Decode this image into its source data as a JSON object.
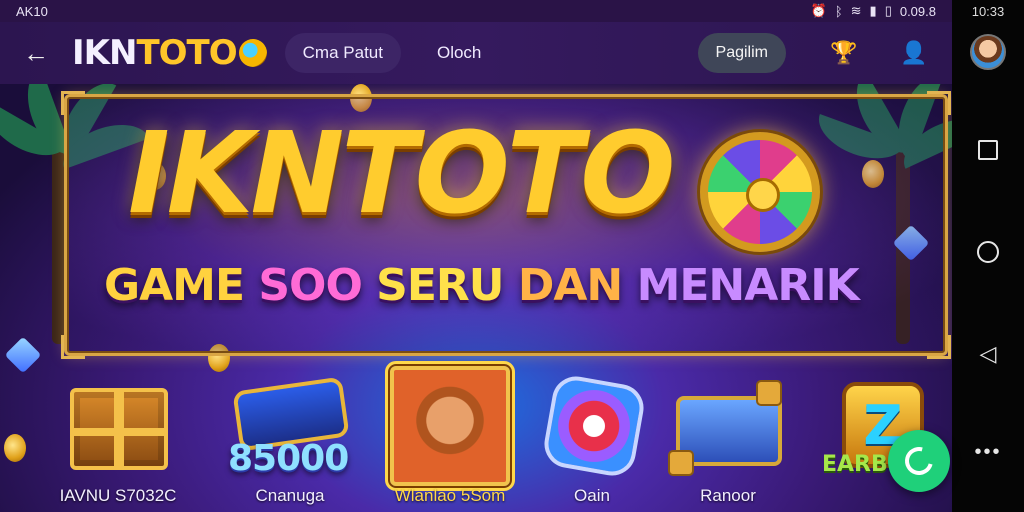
{
  "status_bar": {
    "left_text": "AK10",
    "battery_text": "0.09.8",
    "clock": "10:33"
  },
  "header": {
    "back_label": "←",
    "logo_white": "IKN",
    "logo_gold": "TOTO",
    "nav_pill": "Cma Patut",
    "nav_link": "Oloch",
    "lang_button": "Pagilim"
  },
  "banner": {
    "title": "IKNTOTO",
    "subtitle_parts": [
      "GAME",
      "SOO",
      "SERU",
      "DAN",
      "MENARIK"
    ]
  },
  "tiles": [
    {
      "label": "IAVNU S7032C"
    },
    {
      "label": "Cnanuga",
      "badge": "85000"
    },
    {
      "label": "Wlanlao 5Som"
    },
    {
      "label": "Oain"
    },
    {
      "label": "Ranoor"
    }
  ],
  "z_badge": {
    "letter": "Z",
    "text": "EARB"
  },
  "colors": {
    "accent_gold": "#ffcc2e",
    "fab_green": "#1fd07a",
    "header_bg": "#2c1550"
  }
}
